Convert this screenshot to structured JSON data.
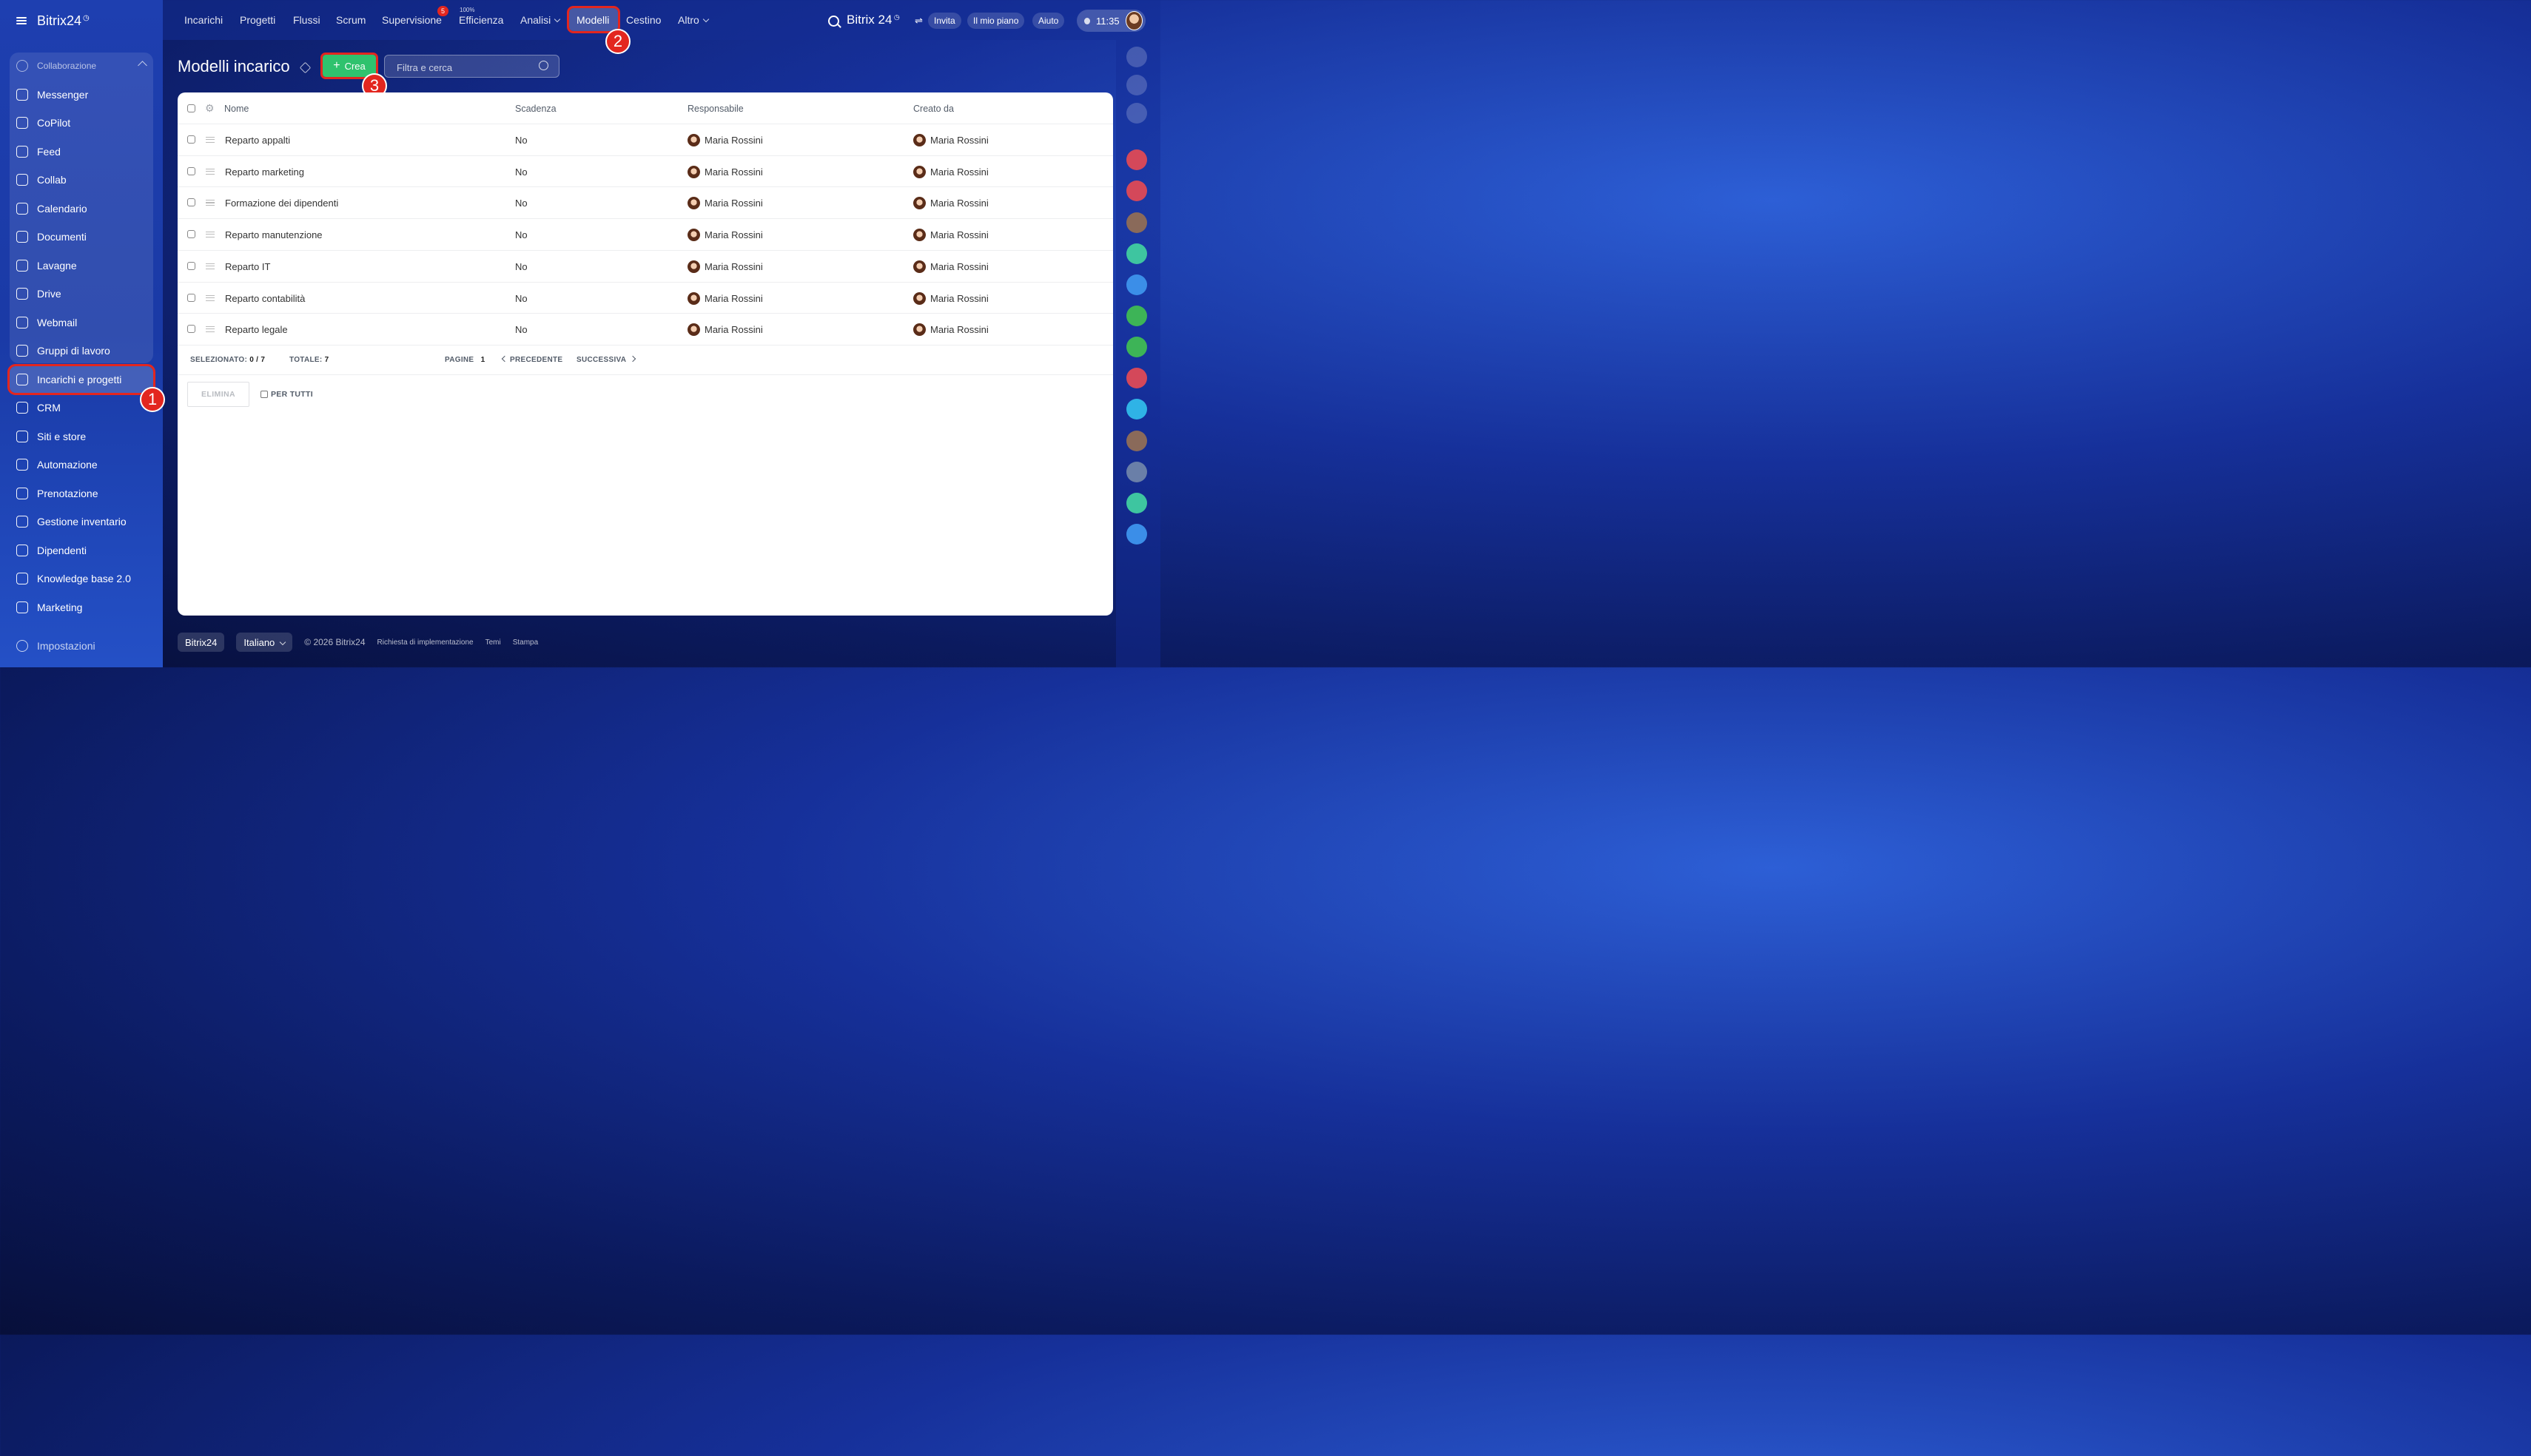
{
  "app": {
    "brand": "Bitrix24",
    "clock": "11:35"
  },
  "sidebar": {
    "section": "Collaborazione",
    "items": [
      {
        "label": "Messenger",
        "icon": "chat-icon"
      },
      {
        "label": "CoPilot",
        "icon": "copilot-icon"
      },
      {
        "label": "Feed",
        "icon": "feed-icon"
      },
      {
        "label": "Collab",
        "icon": "collab-icon"
      },
      {
        "label": "Calendario",
        "icon": "calendar-icon"
      },
      {
        "label": "Documenti",
        "icon": "document-icon"
      },
      {
        "label": "Lavagne",
        "icon": "board-icon"
      },
      {
        "label": "Drive",
        "icon": "drive-icon"
      },
      {
        "label": "Webmail",
        "icon": "mail-icon"
      },
      {
        "label": "Gruppi di lavoro",
        "icon": "group-icon"
      },
      {
        "label": "Incarichi e progetti",
        "icon": "task-check-icon"
      },
      {
        "label": "CRM",
        "icon": "crm-icon"
      },
      {
        "label": "Siti e store",
        "icon": "cart-icon"
      },
      {
        "label": "Automazione",
        "icon": "robot-icon"
      },
      {
        "label": "Prenotazione",
        "icon": "booking-icon"
      },
      {
        "label": "Gestione inventario",
        "icon": "inventory-icon"
      },
      {
        "label": "Dipendenti",
        "icon": "employees-icon"
      },
      {
        "label": "Knowledge base 2.0",
        "icon": "books-icon"
      },
      {
        "label": "Marketing",
        "icon": "target-icon"
      }
    ],
    "settings": "Impostazioni"
  },
  "topnav": {
    "items": [
      "Incarichi",
      "Progetti",
      "Flussi",
      "Scrum",
      "Supervisione",
      "Efficienza",
      "Analisi",
      "Modelli",
      "Cestino",
      "Altro"
    ],
    "supervisione_count": "5",
    "efficienza_sup": "100%",
    "logo": "Bitrix 24",
    "invite": "Invita",
    "plan": "Il mio piano",
    "help": "Aiuto"
  },
  "page": {
    "title": "Modelli incarico",
    "create_label": "Crea",
    "filter_placeholder": "Filtra e cerca"
  },
  "grid": {
    "columns": {
      "name": "Nome",
      "deadline": "Scadenza",
      "responsible": "Responsabile",
      "created_by": "Creato da"
    },
    "rows": [
      {
        "name": "Reparto appalti",
        "deadline": "No",
        "responsible": "Maria Rossini",
        "created_by": "Maria Rossini"
      },
      {
        "name": "Reparto marketing",
        "deadline": "No",
        "responsible": "Maria Rossini",
        "created_by": "Maria Rossini"
      },
      {
        "name": "Formazione dei dipendenti",
        "deadline": "No",
        "responsible": "Maria Rossini",
        "created_by": "Maria Rossini"
      },
      {
        "name": "Reparto manutenzione",
        "deadline": "No",
        "responsible": "Maria Rossini",
        "created_by": "Maria Rossini"
      },
      {
        "name": "Reparto IT",
        "deadline": "No",
        "responsible": "Maria Rossini",
        "created_by": "Maria Rossini"
      },
      {
        "name": "Reparto contabilità",
        "deadline": "No",
        "responsible": "Maria Rossini",
        "created_by": "Maria Rossini"
      },
      {
        "name": "Reparto legale",
        "deadline": "No",
        "responsible": "Maria Rossini",
        "created_by": "Maria Rossini"
      }
    ],
    "footer": {
      "selected_label": "SELEZIONATO:",
      "selected_value": "0 / 7",
      "total_label": "TOTALE:",
      "total_value": "7",
      "pages_label": "PAGINE",
      "pages_value": "1",
      "prev": "PRECEDENTE",
      "next": "SUCCESSIVA",
      "delete": "ELIMINA",
      "for_all": "PER TUTTI"
    }
  },
  "footer": {
    "brand": "Bitrix24",
    "language": "Italiano",
    "copyright": "© 2026 Bitrix24",
    "implementation": "Richiesta di implementazione",
    "themes": "Temi",
    "print": "Stampa"
  },
  "annotations": {
    "step1": "1",
    "step2": "2",
    "step3": "3",
    "color": "#e3261f"
  }
}
